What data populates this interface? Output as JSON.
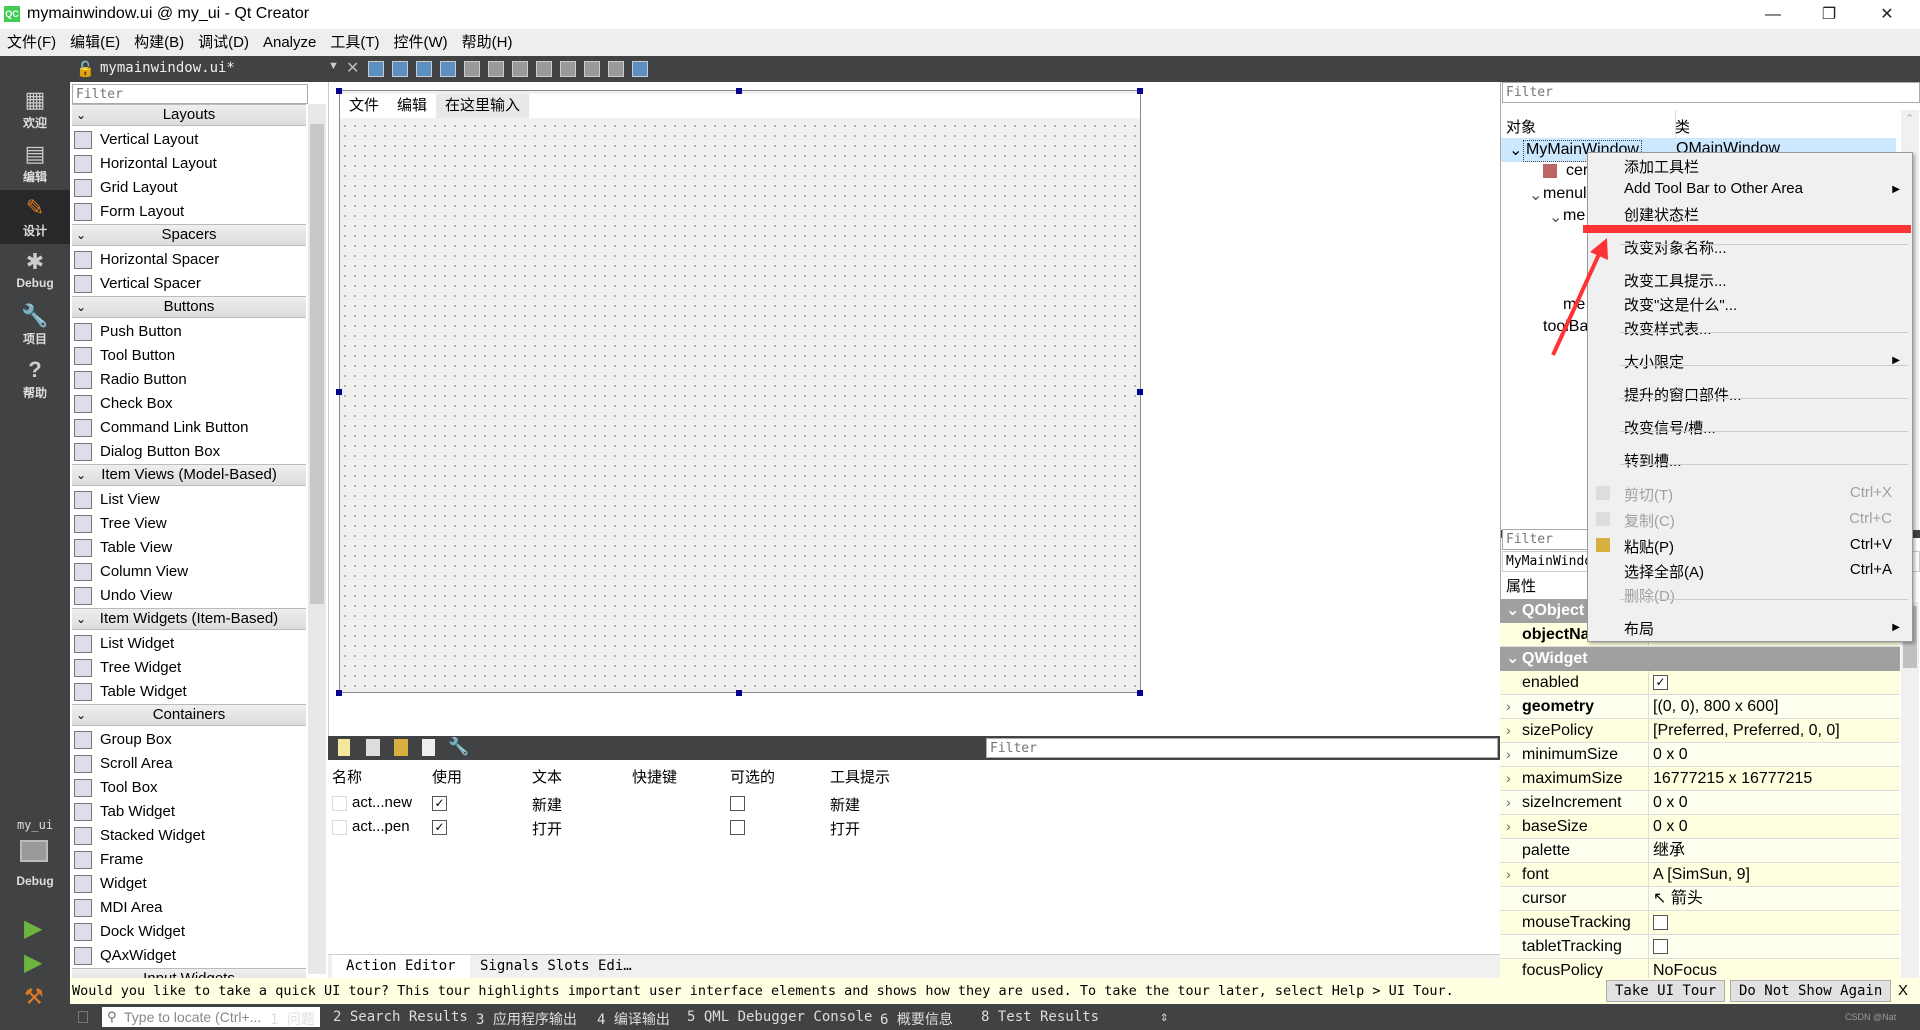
{
  "window": {
    "title": "mymainwindow.ui @ my_ui - Qt Creator",
    "logo": "QC"
  },
  "menubar": [
    "文件(F)",
    "编辑(E)",
    "构建(B)",
    "调试(D)",
    "Analyze",
    "工具(T)",
    "控件(W)",
    "帮助(H)"
  ],
  "toolbar": {
    "document": "mymainwindow.ui*"
  },
  "modes": [
    {
      "label": "欢迎",
      "icon": "grid-icon"
    },
    {
      "label": "编辑",
      "icon": "document-icon"
    },
    {
      "label": "设计",
      "icon": "pencil-icon",
      "active": true
    },
    {
      "label": "Debug",
      "icon": "bug-icon"
    },
    {
      "label": "项目",
      "icon": "wrench-icon"
    },
    {
      "label": "帮助",
      "icon": "help-icon"
    }
  ],
  "kit": {
    "project": "my_ui",
    "mode": "Debug"
  },
  "widgetbox": {
    "filter_placeholder": "Filter",
    "sections": [
      {
        "title": "Layouts",
        "items": [
          "Vertical Layout",
          "Horizontal Layout",
          "Grid Layout",
          "Form Layout"
        ]
      },
      {
        "title": "Spacers",
        "items": [
          "Horizontal Spacer",
          "Vertical Spacer"
        ]
      },
      {
        "title": "Buttons",
        "items": [
          "Push Button",
          "Tool Button",
          "Radio Button",
          "Check Box",
          "Command Link Button",
          "Dialog Button Box"
        ]
      },
      {
        "title": "Item Views (Model-Based)",
        "items": [
          "List View",
          "Tree View",
          "Table View",
          "Column View",
          "Undo View"
        ]
      },
      {
        "title": "Item Widgets (Item-Based)",
        "items": [
          "List Widget",
          "Tree Widget",
          "Table Widget"
        ]
      },
      {
        "title": "Containers",
        "items": [
          "Group Box",
          "Scroll Area",
          "Tool Box",
          "Tab Widget",
          "Stacked Widget",
          "Frame",
          "Widget",
          "MDI Area",
          "Dock Widget",
          "QAxWidget"
        ]
      },
      {
        "title": "Input Widgets",
        "items": []
      }
    ]
  },
  "form": {
    "menus": [
      "文件",
      "编辑",
      "在这里输入"
    ]
  },
  "action_editor": {
    "filter_placeholder": "Filter",
    "columns": [
      "名称",
      "使用",
      "文本",
      "快捷键",
      "可选的",
      "工具提示"
    ],
    "rows": [
      {
        "name": "act...new",
        "used": true,
        "text": "新建",
        "shortcut": "",
        "checkable": false,
        "tooltip": "新建"
      },
      {
        "name": "act...pen",
        "used": true,
        "text": "打开",
        "shortcut": "",
        "checkable": false,
        "tooltip": "打开"
      }
    ],
    "tabs": [
      "Action Editor",
      "Signals  Slots Edi…"
    ]
  },
  "object_inspector": {
    "filter_placeholder": "Filter",
    "columns": [
      "对象",
      "类"
    ],
    "tree": [
      {
        "name": "MyMainWindow",
        "class": "QMainWindow"
      },
      {
        "name": "cer"
      },
      {
        "name": "menul"
      },
      {
        "name": "me"
      },
      {
        "name": "me"
      },
      {
        "name": "toolBa"
      }
    ]
  },
  "property_editor": {
    "filter_placeholder": "Filter",
    "object": "MyMainWindo",
    "header": "属性",
    "groups": [
      {
        "name": "QObject",
        "rows": [
          {
            "name": "objectNa",
            "value": "",
            "bold": true
          }
        ]
      },
      {
        "name": "QWidget",
        "rows": [
          {
            "name": "enabled",
            "checkbox": true,
            "checked": true
          },
          {
            "name": "geometry",
            "value": "[(0, 0), 800 x 600]",
            "bold": true,
            "expandable": true
          },
          {
            "name": "sizePolicy",
            "value": "[Preferred, Preferred, 0, 0]",
            "expandable": true
          },
          {
            "name": "minimumSize",
            "value": "0 x 0",
            "expandable": true
          },
          {
            "name": "maximumSize",
            "value": "16777215 x 16777215",
            "expandable": true
          },
          {
            "name": "sizeIncrement",
            "value": "0 x 0",
            "expandable": true
          },
          {
            "name": "baseSize",
            "value": "0 x 0",
            "expandable": true
          },
          {
            "name": "palette",
            "value": "继承"
          },
          {
            "name": "font",
            "value": "A  [SimSun, 9]",
            "expandable": true
          },
          {
            "name": "cursor",
            "value": "↖  箭头"
          },
          {
            "name": "mouseTracking",
            "checkbox": true,
            "checked": false
          },
          {
            "name": "tabletTracking",
            "checkbox": true,
            "checked": false
          },
          {
            "name": "focusPolicy",
            "value": "NoFocus"
          }
        ]
      }
    ]
  },
  "context_menu": {
    "items": [
      {
        "label": "添加工具栏"
      },
      {
        "label": "Add Tool Bar to Other Area",
        "submenu": true
      },
      {
        "label": "创建状态栏"
      },
      {
        "label": "改变对象名称..."
      },
      {
        "label": "改变工具提示..."
      },
      {
        "label": "改变\"这是什么\"..."
      },
      {
        "label": "改变样式表..."
      },
      {
        "label": "大小限定",
        "submenu": true
      },
      {
        "label": "提升的窗口部件..."
      },
      {
        "label": "改变信号/槽..."
      },
      {
        "label": "转到槽..."
      },
      {
        "label": "剪切(T)",
        "shortcut": "Ctrl+X",
        "disabled": true,
        "icon": "scissors-icon"
      },
      {
        "label": "复制(C)",
        "shortcut": "Ctrl+C",
        "disabled": true,
        "icon": "copy-icon"
      },
      {
        "label": "粘贴(P)",
        "shortcut": "Ctrl+V",
        "icon": "paste-icon"
      },
      {
        "label": "选择全部(A)",
        "shortcut": "Ctrl+A"
      },
      {
        "label": "删除(D)",
        "disabled": true
      },
      {
        "label": "布局",
        "submenu": true
      }
    ],
    "highlight_color": "#ff3333"
  },
  "tour": {
    "message": "Would you like to take a quick UI tour? This tour highlights important user interface elements and shows how they are used. To take the tour later, select Help > UI Tour.",
    "take": "Take UI Tour",
    "dismiss": "Do Not Show Again",
    "close": "X"
  },
  "statusbar": {
    "locate_placeholder": "Type to locate (Ctrl+...",
    "panes": [
      "1 问题",
      "2 Search Results",
      "3 应用程序输出",
      "4 编译输出",
      "5 QML Debugger Console",
      "6 概要信息",
      "8 Test Results"
    ],
    "watermark": "CSDN @Nat"
  }
}
